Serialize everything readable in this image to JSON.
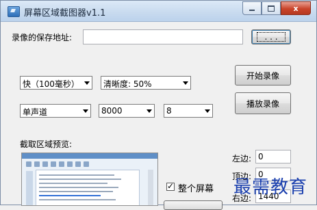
{
  "window": {
    "title": "屏幕区域截图器v1.1",
    "close_label": "x"
  },
  "save_path": {
    "label": "录像的保存地址:",
    "value": "",
    "browse_label": "...",
    "browse_label_alt": ". . ."
  },
  "speed": {
    "selected": "快（100毫秒）"
  },
  "clarity": {
    "selected": "清晰度: 50%"
  },
  "channel": {
    "selected": "单声道"
  },
  "sample_rate": {
    "selected": "8000"
  },
  "bits": {
    "selected": "8"
  },
  "actions": {
    "start_record": "开始录像",
    "play_record": "播放录像"
  },
  "preview": {
    "label": "截取区域预览:"
  },
  "fullscreen": {
    "label": "整个屏幕",
    "checked": true
  },
  "region": {
    "left_label": "左边:",
    "left_value": "0",
    "top_label": "顶边:",
    "top_value": "0",
    "right_label": "右边:",
    "right_value": "1440"
  },
  "watermark": {
    "text": "最需教育"
  },
  "colors": {
    "title_bar": "#c9dbef",
    "close_button": "#c9442a",
    "watermark": "#1a3fae"
  }
}
